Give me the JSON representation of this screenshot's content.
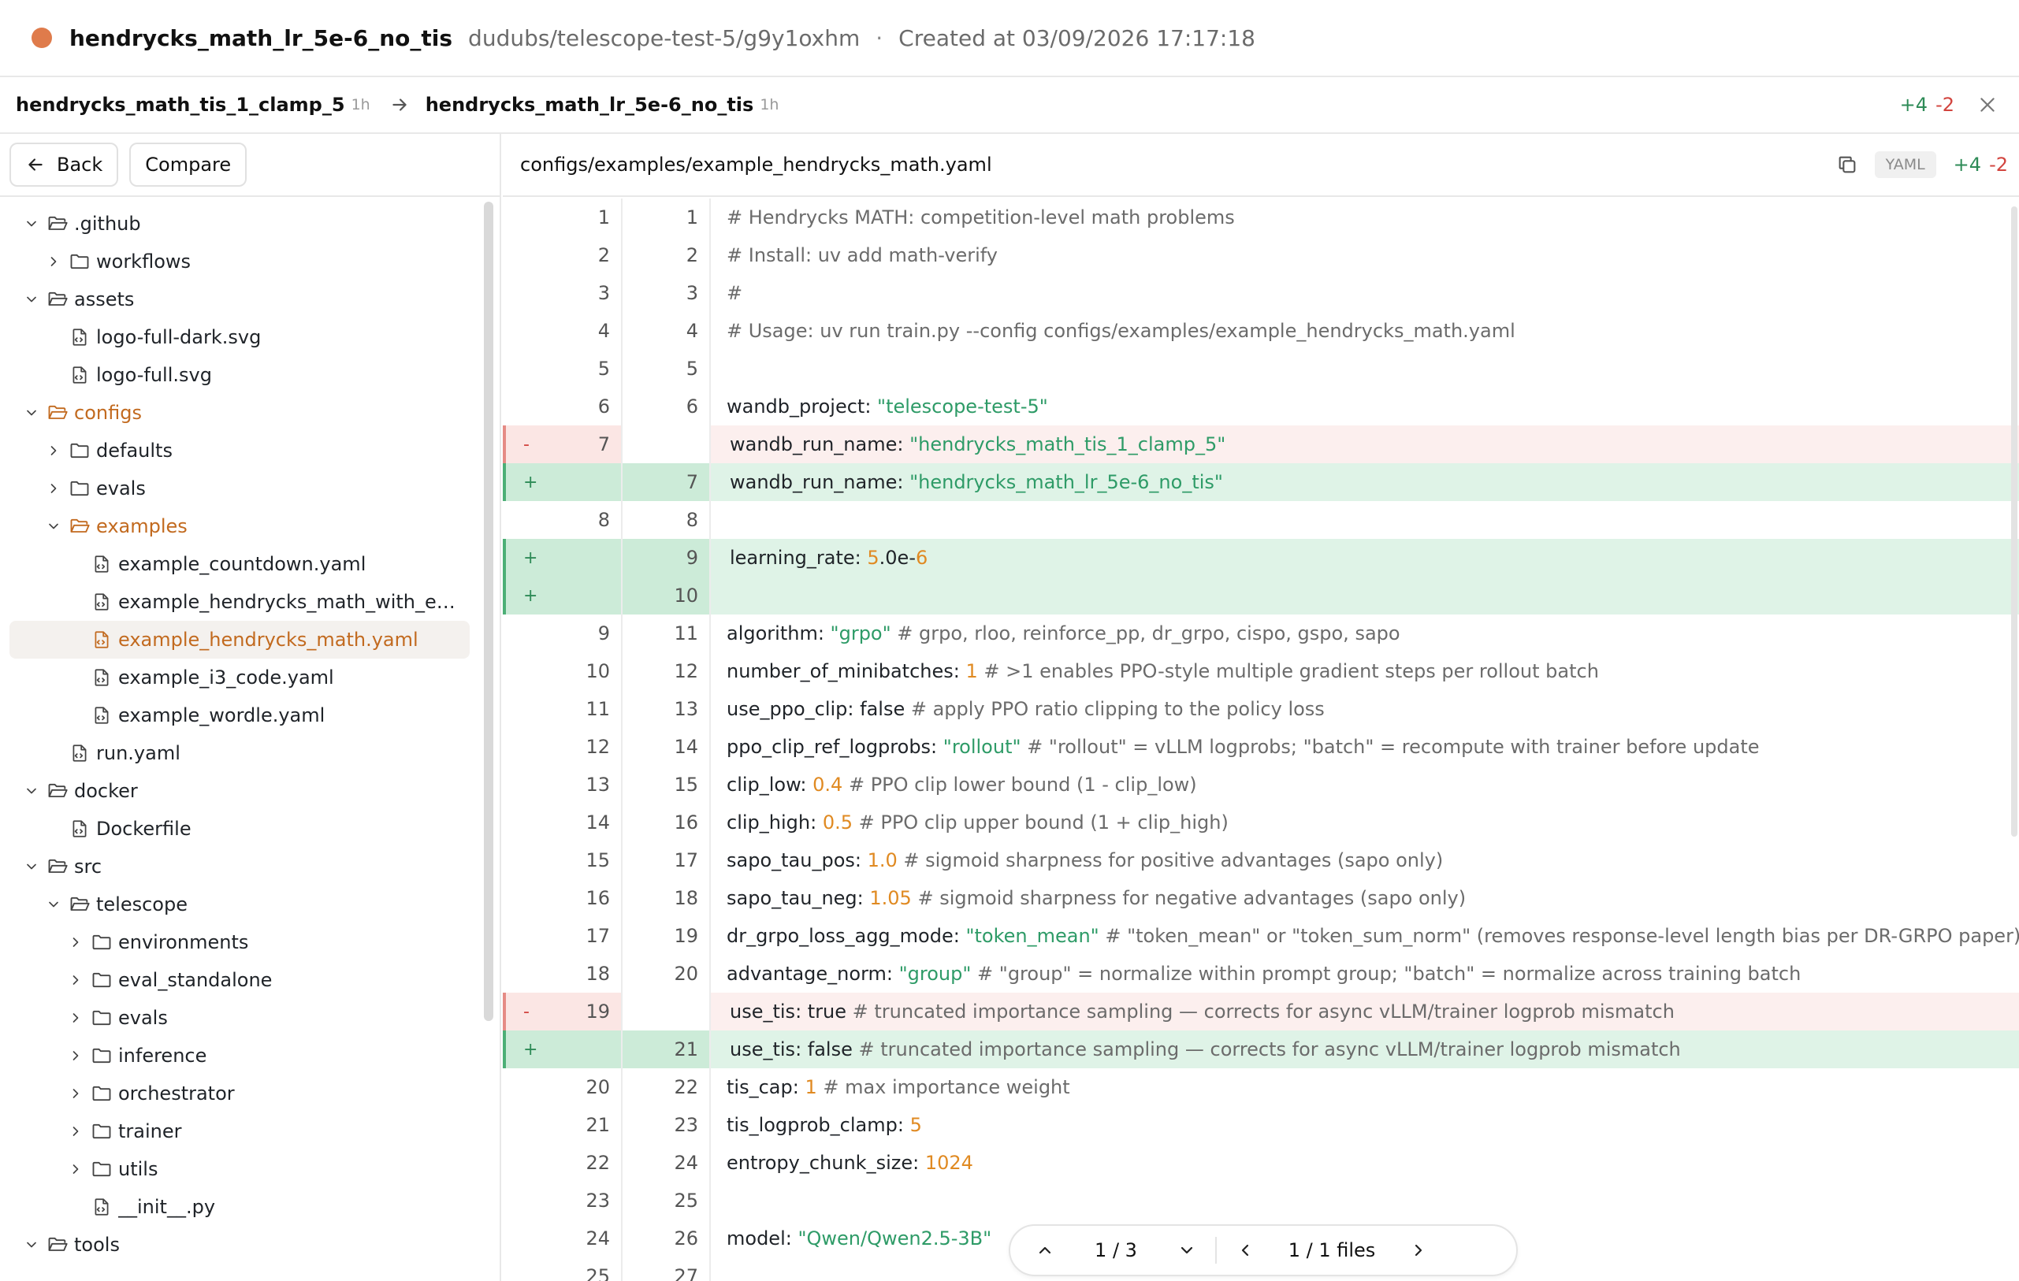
{
  "header": {
    "run_name": "hendrycks_math_lr_5e-6_no_tis",
    "run_path": "dudubs/telescope-test-5/g9y1oxhm",
    "separator": "·",
    "created": "Created at 03/09/2026 17:17:18",
    "status_color": "#df7b4b"
  },
  "compare": {
    "base_run": "hendrycks_math_tis_1_clamp_5",
    "base_age": "1h",
    "target_run": "hendrycks_math_lr_5e-6_no_tis",
    "target_age": "1h",
    "additions": "+4",
    "deletions": "-2"
  },
  "toolbar": {
    "back_label": "Back",
    "compare_label": "Compare"
  },
  "tree": [
    {
      "label": ".github",
      "kind": "folder",
      "level": 0,
      "expanded": true
    },
    {
      "label": "workflows",
      "kind": "folder",
      "level": 1,
      "expanded": false
    },
    {
      "label": "assets",
      "kind": "folder",
      "level": 0,
      "expanded": true
    },
    {
      "label": "logo-full-dark.svg",
      "kind": "file",
      "level": 1
    },
    {
      "label": "logo-full.svg",
      "kind": "file",
      "level": 1
    },
    {
      "label": "configs",
      "kind": "folder",
      "level": 0,
      "expanded": true,
      "active": true
    },
    {
      "label": "defaults",
      "kind": "folder",
      "level": 1,
      "expanded": false
    },
    {
      "label": "evals",
      "kind": "folder",
      "level": 1,
      "expanded": false
    },
    {
      "label": "examples",
      "kind": "folder",
      "level": 1,
      "expanded": true,
      "active": true
    },
    {
      "label": "example_countdown.yaml",
      "kind": "file",
      "level": 2
    },
    {
      "label": "example_hendrycks_math_with_e…",
      "kind": "file",
      "level": 2
    },
    {
      "label": "example_hendrycks_math.yaml",
      "kind": "file",
      "level": 2,
      "selected": true
    },
    {
      "label": "example_i3_code.yaml",
      "kind": "file",
      "level": 2
    },
    {
      "label": "example_wordle.yaml",
      "kind": "file",
      "level": 2
    },
    {
      "label": "run.yaml",
      "kind": "file",
      "level": 1
    },
    {
      "label": "docker",
      "kind": "folder",
      "level": 0,
      "expanded": true
    },
    {
      "label": "Dockerfile",
      "kind": "file",
      "level": 1
    },
    {
      "label": "src",
      "kind": "folder",
      "level": 0,
      "expanded": true
    },
    {
      "label": "telescope",
      "kind": "folder",
      "level": 1,
      "expanded": true
    },
    {
      "label": "environments",
      "kind": "folder",
      "level": 2,
      "expanded": false
    },
    {
      "label": "eval_standalone",
      "kind": "folder",
      "level": 2,
      "expanded": false
    },
    {
      "label": "evals",
      "kind": "folder",
      "level": 2,
      "expanded": false
    },
    {
      "label": "inference",
      "kind": "folder",
      "level": 2,
      "expanded": false
    },
    {
      "label": "orchestrator",
      "kind": "folder",
      "level": 2,
      "expanded": false
    },
    {
      "label": "trainer",
      "kind": "folder",
      "level": 2,
      "expanded": false
    },
    {
      "label": "utils",
      "kind": "folder",
      "level": 2,
      "expanded": false
    },
    {
      "label": "__init__.py",
      "kind": "file",
      "level": 2
    },
    {
      "label": "tools",
      "kind": "folder",
      "level": 0,
      "expanded": true
    }
  ],
  "diff": {
    "file_path": "configs/examples/example_hendrycks_math.yaml",
    "language": "YAML",
    "additions": "+4",
    "deletions": "-2",
    "lines": [
      {
        "old": "1",
        "new": "1",
        "type": "ctx",
        "segs": [
          [
            "c",
            "# Hendrycks MATH: competition-level math problems"
          ]
        ]
      },
      {
        "old": "2",
        "new": "2",
        "type": "ctx",
        "segs": [
          [
            "c",
            "# Install: uv add math-verify"
          ]
        ]
      },
      {
        "old": "3",
        "new": "3",
        "type": "ctx",
        "segs": [
          [
            "c",
            "#"
          ]
        ]
      },
      {
        "old": "4",
        "new": "4",
        "type": "ctx",
        "segs": [
          [
            "c",
            "# Usage: uv run train.py --config configs/examples/example_hendrycks_math.yaml"
          ]
        ]
      },
      {
        "old": "5",
        "new": "5",
        "type": "ctx",
        "segs": []
      },
      {
        "old": "6",
        "new": "6",
        "type": "ctx",
        "segs": [
          [
            "k",
            "wandb_project: "
          ],
          [
            "s",
            "\"telescope-test-5\""
          ]
        ]
      },
      {
        "old": "7",
        "new": "",
        "type": "del",
        "segs": [
          [
            "k",
            "wandb_run_name: "
          ],
          [
            "s",
            "\"hendrycks_math_tis_1_clamp_5\""
          ]
        ]
      },
      {
        "old": "",
        "new": "7",
        "type": "add",
        "segs": [
          [
            "k",
            "wandb_run_name: "
          ],
          [
            "s",
            "\"hendrycks_math_lr_5e-6_no_tis\""
          ]
        ]
      },
      {
        "old": "8",
        "new": "8",
        "type": "ctx",
        "segs": []
      },
      {
        "old": "",
        "new": "9",
        "type": "add",
        "segs": [
          [
            "k",
            "learning_rate: "
          ],
          [
            "n",
            "5"
          ],
          [
            "k",
            ".0e-"
          ],
          [
            "n",
            "6"
          ]
        ]
      },
      {
        "old": "",
        "new": "10",
        "type": "add",
        "segs": []
      },
      {
        "old": "9",
        "new": "11",
        "type": "ctx",
        "segs": [
          [
            "k",
            "algorithm: "
          ],
          [
            "s",
            "\"grpo\""
          ],
          [
            "c",
            " # grpo, rloo, reinforce_pp, dr_grpo, cispo, gspo, sapo"
          ]
        ]
      },
      {
        "old": "10",
        "new": "12",
        "type": "ctx",
        "segs": [
          [
            "k",
            "number_of_minibatches: "
          ],
          [
            "n",
            "1"
          ],
          [
            "c",
            " # >1 enables PPO-style multiple gradient steps per rollout batch"
          ]
        ]
      },
      {
        "old": "11",
        "new": "13",
        "type": "ctx",
        "segs": [
          [
            "k",
            "use_ppo_clip: false"
          ],
          [
            "c",
            " # apply PPO ratio clipping to the policy loss"
          ]
        ]
      },
      {
        "old": "12",
        "new": "14",
        "type": "ctx",
        "segs": [
          [
            "k",
            "ppo_clip_ref_logprobs: "
          ],
          [
            "s",
            "\"rollout\""
          ],
          [
            "c",
            " # \"rollout\" = vLLM logprobs; \"batch\" = recompute with trainer before update"
          ]
        ]
      },
      {
        "old": "13",
        "new": "15",
        "type": "ctx",
        "segs": [
          [
            "k",
            "clip_low: "
          ],
          [
            "n",
            "0.4"
          ],
          [
            "c",
            " # PPO clip lower bound (1 - clip_low)"
          ]
        ]
      },
      {
        "old": "14",
        "new": "16",
        "type": "ctx",
        "segs": [
          [
            "k",
            "clip_high: "
          ],
          [
            "n",
            "0.5"
          ],
          [
            "c",
            " # PPO clip upper bound (1 + clip_high)"
          ]
        ]
      },
      {
        "old": "15",
        "new": "17",
        "type": "ctx",
        "segs": [
          [
            "k",
            "sapo_tau_pos: "
          ],
          [
            "n",
            "1.0"
          ],
          [
            "c",
            " # sigmoid sharpness for positive advantages (sapo only)"
          ]
        ]
      },
      {
        "old": "16",
        "new": "18",
        "type": "ctx",
        "segs": [
          [
            "k",
            "sapo_tau_neg: "
          ],
          [
            "n",
            "1.05"
          ],
          [
            "c",
            " # sigmoid sharpness for negative advantages (sapo only)"
          ]
        ]
      },
      {
        "old": "17",
        "new": "19",
        "type": "ctx",
        "segs": [
          [
            "k",
            "dr_grpo_loss_agg_mode: "
          ],
          [
            "s",
            "\"token_mean\""
          ],
          [
            "c",
            " # \"token_mean\" or \"token_sum_norm\" (removes response-level length bias per DR-GRPO paper)"
          ]
        ]
      },
      {
        "old": "18",
        "new": "20",
        "type": "ctx",
        "segs": [
          [
            "k",
            "advantage_norm: "
          ],
          [
            "s",
            "\"group\""
          ],
          [
            "c",
            " # \"group\" = normalize within prompt group; \"batch\" = normalize across training batch"
          ]
        ]
      },
      {
        "old": "19",
        "new": "",
        "type": "del",
        "segs": [
          [
            "k",
            "use_tis: true"
          ],
          [
            "c",
            " # truncated importance sampling — corrects for async vLLM/trainer logprob mismatch"
          ]
        ]
      },
      {
        "old": "",
        "new": "21",
        "type": "add",
        "segs": [
          [
            "k",
            "use_tis: false"
          ],
          [
            "c",
            " # truncated importance sampling — corrects for async vLLM/trainer logprob mismatch"
          ]
        ]
      },
      {
        "old": "20",
        "new": "22",
        "type": "ctx",
        "segs": [
          [
            "k",
            "tis_cap: "
          ],
          [
            "n",
            "1"
          ],
          [
            "c",
            " # max importance weight"
          ]
        ]
      },
      {
        "old": "21",
        "new": "23",
        "type": "ctx",
        "segs": [
          [
            "k",
            "tis_logprob_clamp: "
          ],
          [
            "n",
            "5"
          ]
        ]
      },
      {
        "old": "22",
        "new": "24",
        "type": "ctx",
        "segs": [
          [
            "k",
            "entropy_chunk_size: "
          ],
          [
            "n",
            "1024"
          ]
        ]
      },
      {
        "old": "23",
        "new": "25",
        "type": "ctx",
        "segs": []
      },
      {
        "old": "24",
        "new": "26",
        "type": "ctx",
        "segs": [
          [
            "k",
            "model: "
          ],
          [
            "s",
            "\"Qwen/Qwen2.5-3B\""
          ]
        ]
      },
      {
        "old": "25",
        "new": "27",
        "type": "ctx",
        "segs": []
      }
    ]
  },
  "navigator": {
    "hunk_position": "1 / 3",
    "file_position": "1 / 1 files"
  },
  "colors": {
    "accent": "#c26a1f",
    "add_bg": "#dff3e7",
    "del_bg": "#fcefee",
    "add_text": "#2e8b57",
    "del_text": "#d2443e"
  }
}
